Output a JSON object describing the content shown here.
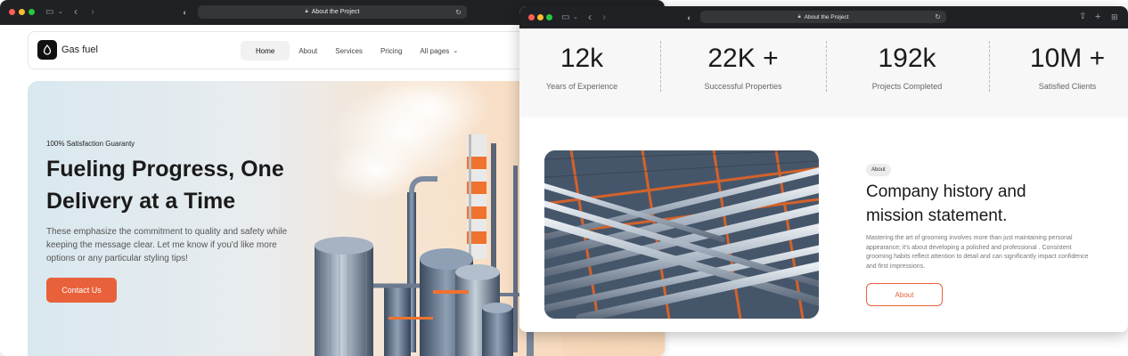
{
  "colors": {
    "accent": "#e8613a",
    "titlebar": "#202124",
    "dot_close": "#ff5f57",
    "dot_min": "#febc2e",
    "dot_max": "#28c840"
  },
  "window1": {
    "url_title": "About the Project",
    "nav": {
      "brand": "Gas fuel",
      "items": [
        {
          "label": "Home",
          "active": true
        },
        {
          "label": "About"
        },
        {
          "label": "Services"
        },
        {
          "label": "Pricing"
        },
        {
          "label": "All pages"
        }
      ]
    },
    "hero": {
      "tagline": "100% Satisfaction Guaranty",
      "title": "Fueling Progress, One Delivery at a Time",
      "description": "These emphasize the commitment to quality and safety while keeping the message clear. Let me know if you'd like more options or any particular styling tips!",
      "cta": "Contact Us"
    }
  },
  "window2": {
    "url_title": "About the Project",
    "stats": [
      {
        "value": "12k",
        "label": "Years of Experience"
      },
      {
        "value": "22K +",
        "label": "Successful Properties"
      },
      {
        "value": "192k",
        "label": "Projects Completed"
      },
      {
        "value": "10M +",
        "label": "Satisfied Clients"
      }
    ],
    "about": {
      "badge": "About",
      "title": "Company history and mission statement.",
      "text": "Mastering the art of grooming involves more than just maintaining personal appearance; it's about developing a polished and professional . Consistent grooming habits reflect attention to detail and can significantly impact confidence and first impressions.",
      "button": "About"
    }
  }
}
